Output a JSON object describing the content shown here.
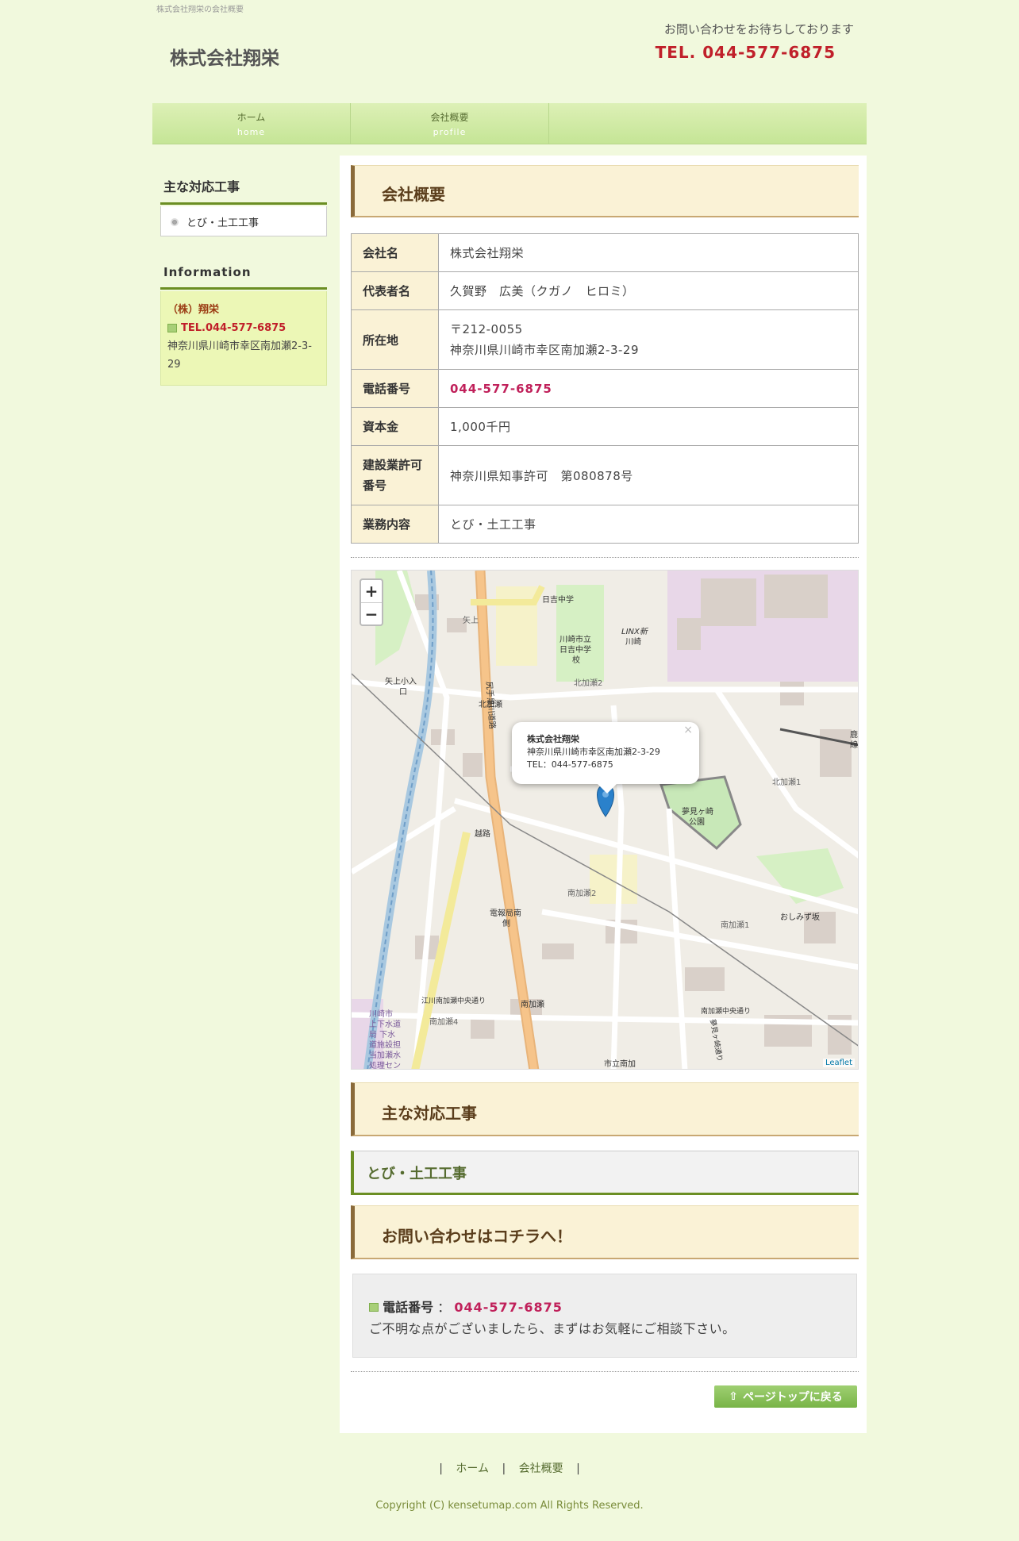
{
  "header": {
    "tagline": "株式会社翔栄の会社概要",
    "logo": "株式会社翔栄",
    "message": "お問い合わせをお待ちしております",
    "tel": "TEL. 044-577-6875"
  },
  "nav": [
    {
      "label": "ホーム",
      "sub": "home"
    },
    {
      "label": "会社概要",
      "sub": "profile"
    }
  ],
  "sidebar": {
    "works_title": "主な対応工事",
    "works_item": "とび・土工工事",
    "info_title": "Information",
    "info_name": "（株）翔栄",
    "info_tel": "TEL.044-577-6875",
    "info_addr": "神奈川県川崎市幸区南加瀬2-3-29"
  },
  "main": {
    "title": "会社概要",
    "rows": [
      {
        "key": "会社名",
        "value": "株式会社翔栄"
      },
      {
        "key": "代表者名",
        "value": "久賀野　広美（クガノ　ヒロミ）"
      },
      {
        "key": "所在地",
        "value": "〒212-0055",
        "value2": "神奈川県川崎市幸区南加瀬2-3-29"
      },
      {
        "key": "電話番号",
        "value": "044-577-6875"
      },
      {
        "key": "資本金",
        "value": "1,000千円"
      },
      {
        "key": "建設業許可番号",
        "value": "神奈川県知事許可　第080878号"
      },
      {
        "key": "業務内容",
        "value": "とび・土工工事"
      }
    ],
    "map": {
      "popup_name": "株式会社翔栄",
      "popup_addr": "神奈川県川崎市幸区南加瀬2-3-29",
      "popup_tel": "TEL：044-577-6875",
      "zoom_in": "+",
      "zoom_out": "−",
      "close": "×",
      "attribution": "Leaflet",
      "labels": [
        "日吉中学",
        "川崎市立",
        "日吉中学",
        "校",
        "LINX新",
        "川崎",
        "北加瀬2",
        "矢上小入",
        "口",
        "矢上",
        "北加瀬",
        "北加瀬1",
        "鹿",
        "線",
        "夢見ヶ崎",
        "公園",
        "越路",
        "南加瀬2",
        "電報局南",
        "側",
        "南加瀬1",
        "おしみず坂",
        "江川南加瀬中央通り",
        "南加瀬",
        "南加瀬中央通り",
        "南加瀬4",
        "市立南加",
        "川崎市",
        "上下水道",
        "局 下水",
        "道施設担",
        "当加瀬水",
        "処理セン",
        "夢見ヶ崎通り",
        "尻手黒川道路"
      ]
    },
    "works_title": "主な対応工事",
    "works_sub": "とび・土工工事",
    "contact_title": "お問い合わせはコチラへ！",
    "contact_label": "電話番号",
    "contact_sep": "：",
    "contact_tel": "044-577-6875",
    "contact_note": "ご不明な点がございましたら、まずはお気軽にご相談下さい。",
    "pagetop": "ページトップに戻る"
  },
  "footer": {
    "sep": "|",
    "links": [
      "ホーム",
      "会社概要"
    ],
    "copyright": "Copyright (C) kensetumap.com All Rights Reserved."
  }
}
